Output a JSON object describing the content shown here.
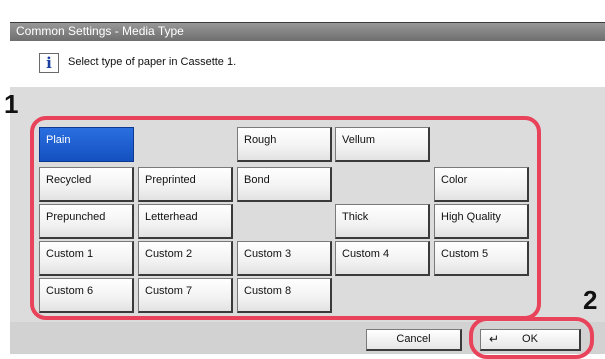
{
  "window": {
    "title": "Common Settings - Media Type"
  },
  "message": {
    "icon": "info-icon",
    "text": "Select type of paper in Cassette 1."
  },
  "callouts": {
    "one": "1",
    "two": "2"
  },
  "media_types": {
    "plain": "Plain",
    "rough": "Rough",
    "vellum": "Vellum",
    "recycled": "Recycled",
    "preprinted": "Preprinted",
    "bond": "Bond",
    "color": "Color",
    "prepunched": "Prepunched",
    "letterhead": "Letterhead",
    "thick": "Thick",
    "high_quality": "High Quality",
    "custom1": "Custom 1",
    "custom2": "Custom 2",
    "custom3": "Custom 3",
    "custom4": "Custom 4",
    "custom5": "Custom 5",
    "custom6": "Custom 6",
    "custom7": "Custom 7",
    "custom8": "Custom 8",
    "selected": "Plain"
  },
  "footer": {
    "cancel_label": "Cancel",
    "ok_label": "OK",
    "ok_icon": "enter-icon"
  },
  "colors": {
    "selected_blue": "#1f5fd6",
    "callout_red": "#e8435a"
  }
}
